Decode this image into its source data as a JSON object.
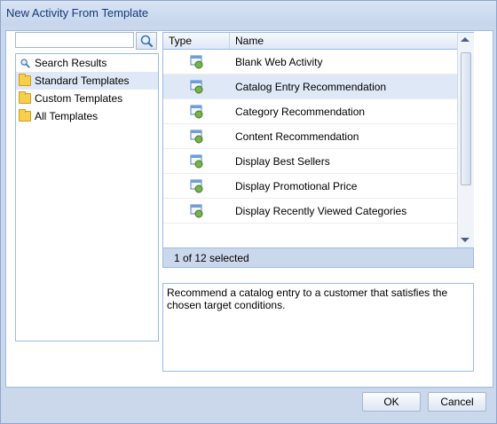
{
  "window": {
    "title": "New Activity From Template"
  },
  "search": {
    "value": "",
    "button_icon": "magnifier-icon"
  },
  "tree": {
    "items": [
      {
        "label": "Search Results",
        "icon": "search-icon",
        "selected": false
      },
      {
        "label": "Standard Templates",
        "icon": "folder-icon",
        "selected": true
      },
      {
        "label": "Custom Templates",
        "icon": "folder-icon",
        "selected": false
      },
      {
        "label": "All Templates",
        "icon": "folder-icon",
        "selected": false
      }
    ]
  },
  "grid": {
    "columns": [
      "Type",
      "Name"
    ],
    "rows": [
      {
        "name": "Blank Web Activity",
        "icon": "web-activity-icon",
        "selected": false
      },
      {
        "name": "Catalog Entry Recommendation",
        "icon": "web-activity-icon",
        "selected": true
      },
      {
        "name": "Category Recommendation",
        "icon": "web-activity-icon",
        "selected": false
      },
      {
        "name": "Content Recommendation",
        "icon": "web-activity-icon",
        "selected": false
      },
      {
        "name": "Display Best Sellers",
        "icon": "web-activity-icon",
        "selected": false
      },
      {
        "name": "Display Promotional Price",
        "icon": "web-activity-icon",
        "selected": false
      },
      {
        "name": "Display Recently Viewed Categories",
        "icon": "web-activity-icon",
        "selected": false
      }
    ],
    "status": "1 of 12 selected"
  },
  "description": "Recommend a catalog entry to a customer that satisfies the chosen target conditions.",
  "buttons": {
    "ok": "OK",
    "cancel": "Cancel"
  },
  "colors": {
    "title": "#15397a",
    "selection": "#dfe8f6",
    "border": "#99bbe8",
    "frame": "#cbd8ec"
  }
}
